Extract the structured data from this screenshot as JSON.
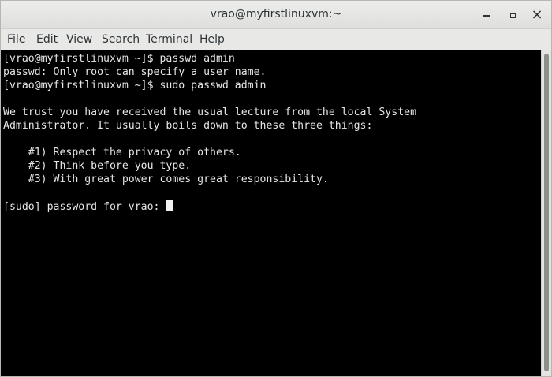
{
  "window": {
    "title": "vrao@myfirstlinuxvm:~",
    "controls": {
      "minimize": "minimize-icon",
      "maximize": "maximize-icon",
      "close": "×"
    }
  },
  "menubar": {
    "items": [
      "File",
      "Edit",
      "View",
      "Search",
      "Terminal",
      "Help"
    ]
  },
  "terminal": {
    "lines": [
      "[vrao@myfirstlinuxvm ~]$ passwd admin",
      "passwd: Only root can specify a user name.",
      "[vrao@myfirstlinuxvm ~]$ sudo passwd admin",
      "",
      "We trust you have received the usual lecture from the local System",
      "Administrator. It usually boils down to these three things:",
      "",
      "    #1) Respect the privacy of others.",
      "    #2) Think before you type.",
      "    #3) With great power comes great responsibility.",
      "",
      "[sudo] password for vrao: "
    ]
  },
  "colors": {
    "terminal_background": "#000000",
    "terminal_foreground": "#e6e6e6",
    "chrome_background": "#e8e8e7"
  }
}
